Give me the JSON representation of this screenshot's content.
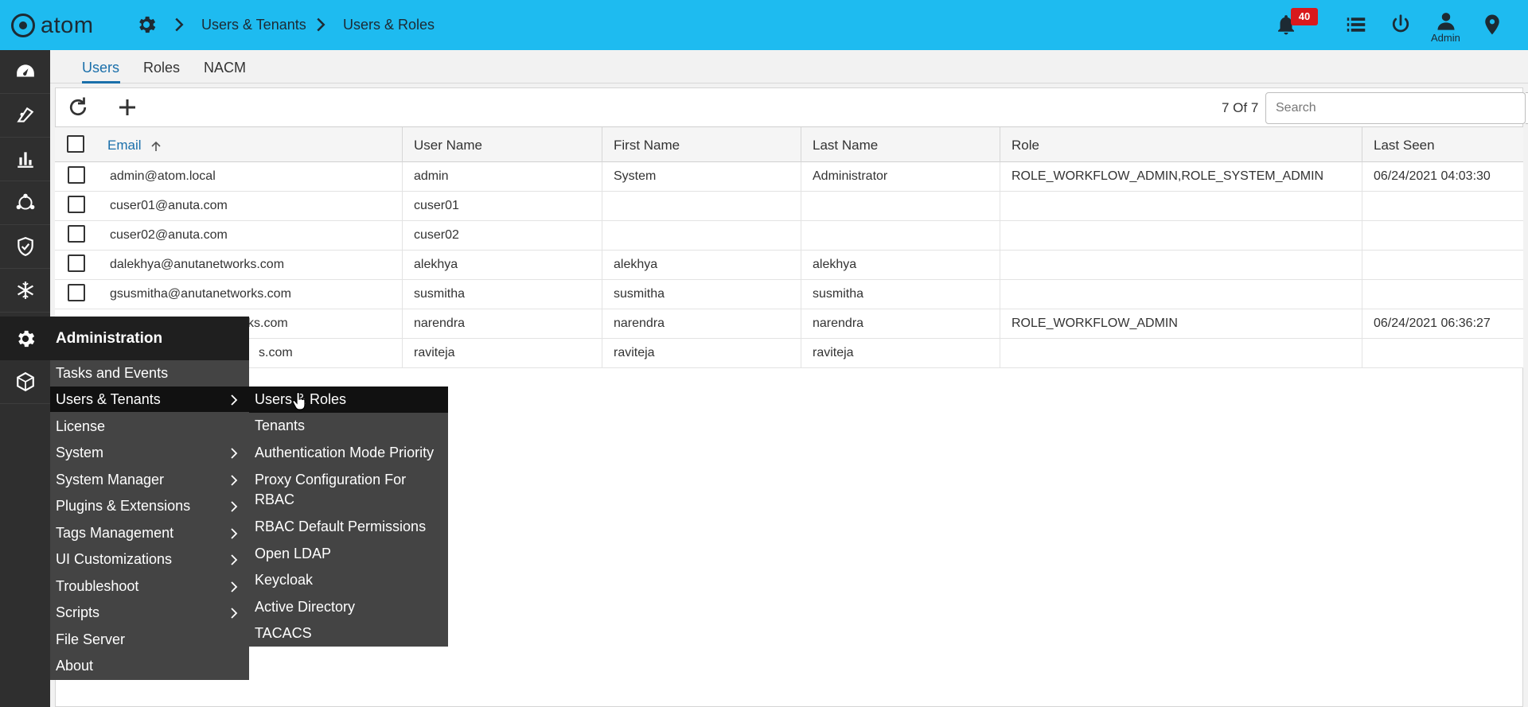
{
  "app": {
    "logo_text": "atom"
  },
  "breadcrumb": {
    "items": [
      "Users & Tenants",
      "Users & Roles"
    ]
  },
  "header": {
    "notification_count": "40",
    "user_label": "Admin"
  },
  "tabs": [
    {
      "label": "Users",
      "active": true
    },
    {
      "label": "Roles",
      "active": false
    },
    {
      "label": "NACM",
      "active": false
    }
  ],
  "toolbar": {
    "count_text": "7 Of 7",
    "search_placeholder": "Search"
  },
  "table": {
    "columns": [
      "Email",
      "User Name",
      "First Name",
      "Last Name",
      "Role",
      "Last Seen"
    ],
    "sorted_column": "Email",
    "rows": [
      {
        "email": "admin@atom.local",
        "username": "admin",
        "first": "System",
        "last": "Administrator",
        "role": "ROLE_WORKFLOW_ADMIN,ROLE_SYSTEM_ADMIN",
        "last_seen": "06/24/2021 04:03:30"
      },
      {
        "email": "cuser01@anuta.com",
        "username": "cuser01",
        "first": "",
        "last": "",
        "role": "",
        "last_seen": ""
      },
      {
        "email": "cuser02@anuta.com",
        "username": "cuser02",
        "first": "",
        "last": "",
        "role": "",
        "last_seen": ""
      },
      {
        "email": "dalekhya@anutanetworks.com",
        "username": "alekhya",
        "first": "alekhya",
        "last": "alekhya",
        "role": "",
        "last_seen": ""
      },
      {
        "email": "gsusmitha@anutanetworks.com",
        "username": "susmitha",
        "first": "susmitha",
        "last": "susmitha",
        "role": "",
        "last_seen": ""
      },
      {
        "email": "ks.com",
        "username": "narendra",
        "first": "narendra",
        "last": "narendra",
        "role": "ROLE_WORKFLOW_ADMIN",
        "last_seen": "06/24/2021 06:36:27"
      },
      {
        "email": "s.com",
        "username": "raviteja",
        "first": "raviteja",
        "last": "raviteja",
        "role": "",
        "last_seen": ""
      }
    ]
  },
  "admin_menu": {
    "title": "Administration",
    "items": [
      {
        "label": "Tasks and Events",
        "has_submenu": false
      },
      {
        "label": "Users & Tenants",
        "has_submenu": true
      },
      {
        "label": "License",
        "has_submenu": false
      },
      {
        "label": "System",
        "has_submenu": true
      },
      {
        "label": "System Manager",
        "has_submenu": true
      },
      {
        "label": "Plugins & Extensions",
        "has_submenu": true
      },
      {
        "label": "Tags Management",
        "has_submenu": true
      },
      {
        "label": "UI Customizations",
        "has_submenu": true
      },
      {
        "label": "Troubleshoot",
        "has_submenu": true
      },
      {
        "label": "Scripts",
        "has_submenu": true
      },
      {
        "label": "File Server",
        "has_submenu": false
      },
      {
        "label": "About",
        "has_submenu": false
      }
    ],
    "selected": "Users & Tenants"
  },
  "submenu": {
    "items": [
      "Users & Roles",
      "Tenants",
      "Authentication Mode Priority",
      "Proxy Configuration For RBAC",
      "RBAC Default Permissions",
      "Open LDAP",
      "Keycloak",
      "Active Directory",
      "TACACS"
    ],
    "selected": "Users & Roles"
  },
  "colors": {
    "topbar": "#1ebbf0",
    "rail": "#2f2f2f",
    "accent": "#1a6faa",
    "badge": "#d9191c",
    "menu": "#444444"
  }
}
